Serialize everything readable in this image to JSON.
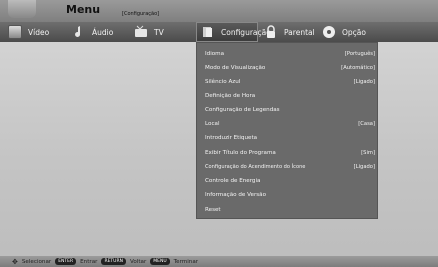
{
  "header": {
    "title": "Menu",
    "subtitle": "[Configuração]"
  },
  "tabs": [
    {
      "label": "Vídeo",
      "icon": "video-icon"
    },
    {
      "label": "Áudio",
      "icon": "audio-icon"
    },
    {
      "label": "TV",
      "icon": "tv-icon"
    },
    {
      "label": "Configuração",
      "icon": "config-icon"
    },
    {
      "label": "Parental",
      "icon": "lock-icon"
    },
    {
      "label": "Opção",
      "icon": "disc-icon"
    }
  ],
  "menu": {
    "items": [
      {
        "label": "Idioma",
        "value": "[Português]"
      },
      {
        "label": "Modo de Visualização",
        "value": "[Automático]"
      },
      {
        "label": "Silêncio Azul",
        "value": "[Ligado]"
      },
      {
        "label": "Definição de Hora",
        "value": ""
      },
      {
        "label": "Configuração de Legendas",
        "value": ""
      },
      {
        "label": "Local",
        "value": "[Casa]"
      },
      {
        "label": "Introduzir Etiqueta",
        "value": ""
      },
      {
        "label": "Exibir Título do Programa",
        "value": "[Sim]"
      },
      {
        "label": "Configuração do Acendimento do Ícone",
        "value": "[Ligado]"
      },
      {
        "label": "Controle de Energia",
        "value": ""
      },
      {
        "label": "Informação de Versão",
        "value": ""
      },
      {
        "label": "Reset",
        "value": ""
      }
    ]
  },
  "footer": {
    "select_label": "Selecionar",
    "enter_key": "ENTER",
    "enter_label": "Entrar",
    "return_key": "RETURN",
    "return_label": "Voltar",
    "menu_key": "MENU",
    "menu_label": "Terminar"
  }
}
